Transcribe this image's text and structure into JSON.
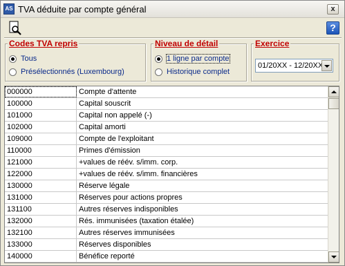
{
  "window": {
    "title": "TVA déduite par compte général",
    "app_icon_text": "AS",
    "close_label": "x",
    "help_label": "?"
  },
  "toolbar": {
    "search_icon": "search-preview-icon"
  },
  "codes_tva": {
    "title": "Codes TVA repris",
    "options": [
      {
        "label": "Tous",
        "selected": true
      },
      {
        "label": "Présélectionnés (Luxembourg)",
        "selected": false
      }
    ]
  },
  "niveau": {
    "title": "Niveau de détail",
    "options": [
      {
        "label": "1 ligne par compte",
        "selected": true
      },
      {
        "label": "Historique complet",
        "selected": false
      }
    ]
  },
  "exercice": {
    "title": "Exercice",
    "value": "01/20XX - 12/20XX"
  },
  "accounts": [
    {
      "code": "000000",
      "label": "Compte d'attente"
    },
    {
      "code": "100000",
      "label": "Capital souscrit"
    },
    {
      "code": "101000",
      "label": "Capital non appelé (-)"
    },
    {
      "code": "102000",
      "label": "Capital amorti"
    },
    {
      "code": "109000",
      "label": "Compte de l'exploitant"
    },
    {
      "code": "110000",
      "label": "Primes d'émission"
    },
    {
      "code": "121000",
      "label": "+values de réév. s/imm. corp."
    },
    {
      "code": "122000",
      "label": "+values de réév. s/imm. financières"
    },
    {
      "code": "130000",
      "label": "Réserve légale"
    },
    {
      "code": "131000",
      "label": "Réserves pour actions propres"
    },
    {
      "code": "131100",
      "label": "Autres réserves indisponibles"
    },
    {
      "code": "132000",
      "label": "Rés.  immunisées (taxation étalée)"
    },
    {
      "code": "132100",
      "label": "Autres réserves immunisées"
    },
    {
      "code": "133000",
      "label": "Réserves disponibles"
    },
    {
      "code": "140000",
      "label": "Bénéfice reporté"
    }
  ]
}
